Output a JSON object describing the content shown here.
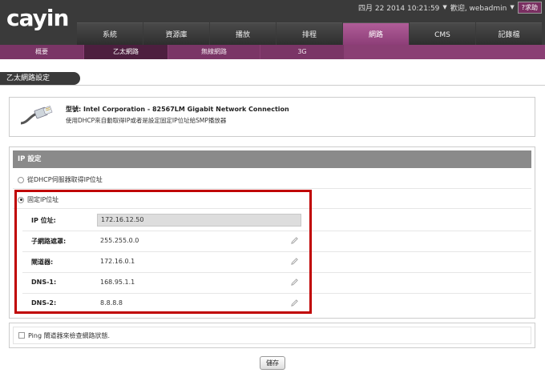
{
  "header": {
    "logo": "cayin",
    "datetime": "四月 22 2014 10:21:59",
    "welcome": "歡迎, webadmin",
    "help": "?求助"
  },
  "tabs": [
    "系統",
    "資源庫",
    "播放",
    "排程",
    "網路",
    "CMS",
    "記錄檔"
  ],
  "active_tab": 4,
  "subtabs": [
    "概要",
    "乙太網路",
    "無線網路",
    "3G"
  ],
  "active_subtab": 1,
  "page_title": "乙太網路設定",
  "device": {
    "model_label": "型號:",
    "model_value": "Intel Corporation - 82567LM Gigabit Network Connection",
    "description": "使用DHCP來自動取得IP或者是設定固定IP位址給SMP播放器"
  },
  "ip_settings": {
    "section_title": "IP 設定",
    "dhcp_option": "從DHCP伺服器取得IP位址",
    "static_option": "固定IP位址",
    "selected": "static",
    "fields": [
      {
        "label": "IP 位址:",
        "value": "172.16.12.50"
      },
      {
        "label": "子網路遮罩:",
        "value": "255.255.0.0"
      },
      {
        "label": "閘道器:",
        "value": "172.16.0.1"
      },
      {
        "label": "DNS-1:",
        "value": "168.95.1.1"
      },
      {
        "label": "DNS-2:",
        "value": "8.8.8.8"
      }
    ]
  },
  "ping_option": "Ping 閘道器來檢查網路狀態.",
  "save_label": "儲存",
  "colors": {
    "header_bg": "#3a3a3a",
    "accent": "#8d3e78",
    "highlight": "#c00000"
  }
}
